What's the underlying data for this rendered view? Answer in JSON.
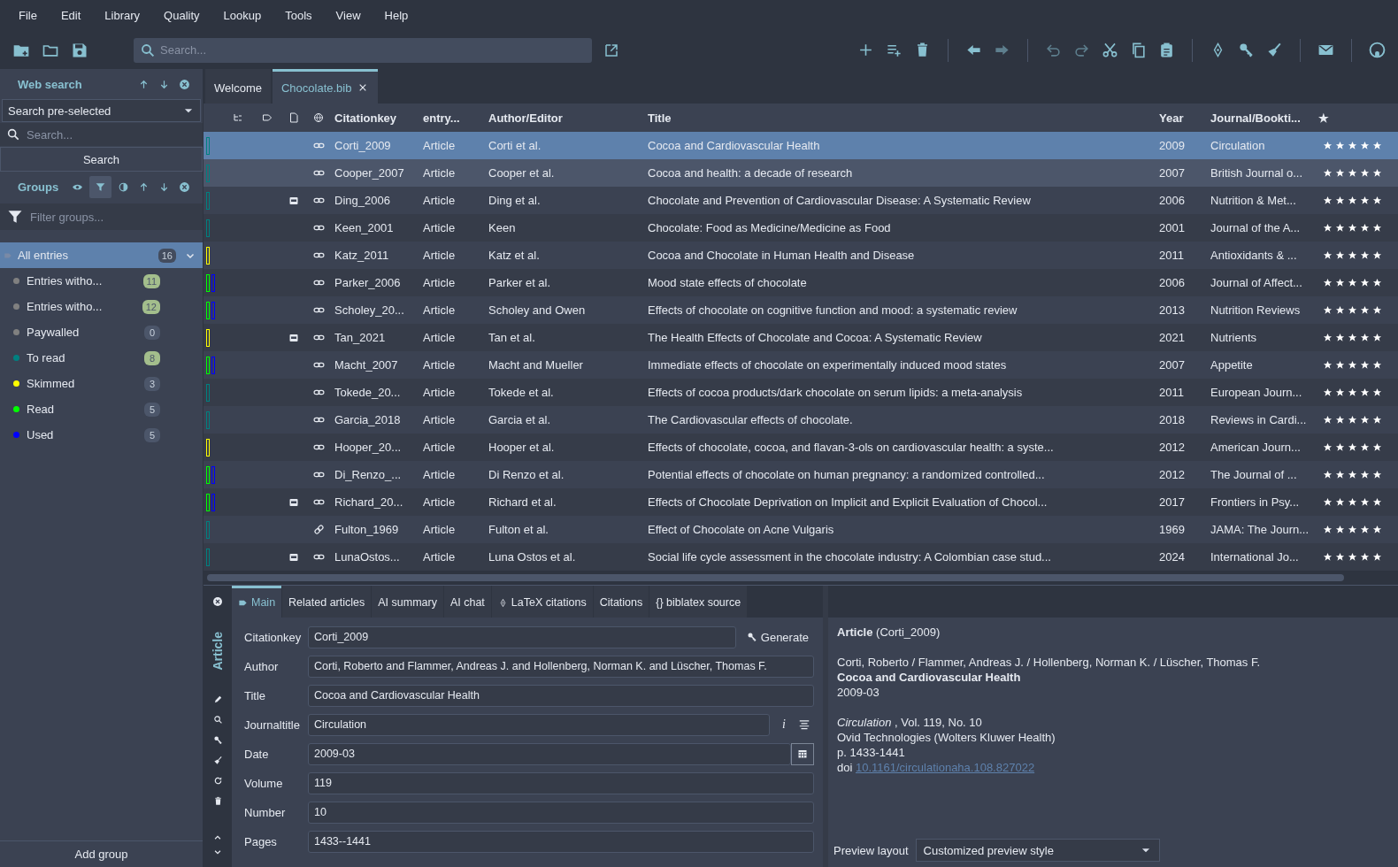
{
  "menu": [
    "File",
    "Edit",
    "Library",
    "Quality",
    "Lookup",
    "Tools",
    "View",
    "Help"
  ],
  "toolbar": {
    "search": {
      "placeholder": "Search..."
    }
  },
  "sidebar": {
    "web_search": {
      "title": "Web search",
      "dropdown": "Search pre-selected",
      "search_placeholder": "Search...",
      "button": "Search"
    },
    "groups": {
      "title": "Groups",
      "filter_placeholder": "Filter groups...",
      "add_button": "Add group",
      "items": [
        {
          "label": "All entries",
          "count": "16",
          "selected": true,
          "expanded": true,
          "children": [
            {
              "label": "Entries witho...",
              "count": "11",
              "color": "#808080",
              "highlighted": true
            },
            {
              "label": "Entries witho...",
              "count": "12",
              "color": "#808080",
              "highlighted": true
            },
            {
              "label": "Paywalled",
              "count": "0",
              "color": "#808080",
              "highlighted": false
            },
            {
              "label": "To read",
              "count": "8",
              "color": "#008080",
              "highlighted": true
            },
            {
              "label": "Skimmed",
              "count": "3",
              "color": "#ffff00",
              "highlighted": false
            },
            {
              "label": "Read",
              "count": "5",
              "color": "#00ff00",
              "highlighted": false
            },
            {
              "label": "Used",
              "count": "5",
              "color": "#0000ff",
              "highlighted": false
            }
          ]
        }
      ]
    }
  },
  "tabs": [
    {
      "label": "Welcome",
      "selected": false,
      "closable": false
    },
    {
      "label": "Chocolate.bib",
      "selected": true,
      "closable": true
    }
  ],
  "table": {
    "columns": [
      "Citationkey",
      "entry...",
      "Author/Editor",
      "Title",
      "Year",
      "Journal/Bookti...",
      "★"
    ],
    "rows": [
      {
        "key": "Corti_2009",
        "type": "Article",
        "author": "Corti et al.",
        "title": "Cocoa and Cardiovascular Health",
        "year": "2009",
        "journal": "Circulation",
        "groups": [
          {
            "color": "#008080"
          }
        ],
        "pdf": false,
        "link_tilted": false,
        "stars": 5,
        "selected": true,
        "hovered": false
      },
      {
        "key": "Cooper_2007",
        "type": "Article",
        "author": "Cooper et al.",
        "title": "Cocoa and health: a decade of research",
        "year": "2007",
        "journal": "British Journal o...",
        "groups": [
          {
            "color": "#008080"
          }
        ],
        "pdf": false,
        "link_tilted": false,
        "stars": 5,
        "selected": false,
        "hovered": true
      },
      {
        "key": "Ding_2006",
        "type": "Article",
        "author": "Ding et al.",
        "title": "Chocolate and Prevention of Cardiovascular Disease: A Systematic Review",
        "year": "2006",
        "journal": "Nutrition & Met...",
        "groups": [
          {
            "color": "#008080"
          }
        ],
        "pdf": true,
        "link_tilted": false,
        "stars": 5,
        "selected": false,
        "hovered": false
      },
      {
        "key": "Keen_2001",
        "type": "Article",
        "author": "Keen",
        "title": "Chocolate: Food as Medicine/Medicine as Food",
        "year": "2001",
        "journal": "Journal of the A...",
        "groups": [
          {
            "color": "#008080"
          }
        ],
        "pdf": false,
        "link_tilted": false,
        "stars": 5,
        "selected": false,
        "hovered": false
      },
      {
        "key": "Katz_2011",
        "type": "Article",
        "author": "Katz et al.",
        "title": "Cocoa and Chocolate in Human Health and Disease",
        "year": "2011",
        "journal": "Antioxidants & ...",
        "groups": [
          {
            "color": "#ffff00"
          }
        ],
        "pdf": false,
        "link_tilted": false,
        "stars": 5,
        "selected": false,
        "hovered": false
      },
      {
        "key": "Parker_2006",
        "type": "Article",
        "author": "Parker et al.",
        "title": "Mood state effects of chocolate",
        "year": "2006",
        "journal": "Journal of Affect...",
        "groups": [
          {
            "color": "#00ff00"
          },
          {
            "color": "#0000ff"
          }
        ],
        "pdf": false,
        "link_tilted": false,
        "stars": 5,
        "selected": false,
        "hovered": false
      },
      {
        "key": "Scholey_20...",
        "type": "Article",
        "author": "Scholey and Owen",
        "title": "Effects of chocolate on cognitive function and mood: a systematic review",
        "year": "2013",
        "journal": "Nutrition Reviews",
        "groups": [
          {
            "color": "#00ff00"
          },
          {
            "color": "#0000ff"
          }
        ],
        "pdf": false,
        "link_tilted": false,
        "stars": 5,
        "selected": false,
        "hovered": false
      },
      {
        "key": "Tan_2021",
        "type": "Article",
        "author": "Tan et al.",
        "title": "The Health Effects of Chocolate and Cocoa: A Systematic Review",
        "year": "2021",
        "journal": "Nutrients",
        "groups": [
          {
            "color": "#ffff00"
          }
        ],
        "pdf": true,
        "link_tilted": false,
        "stars": 5,
        "selected": false,
        "hovered": false
      },
      {
        "key": "Macht_2007",
        "type": "Article",
        "author": "Macht and Mueller",
        "title": "Immediate effects of chocolate on experimentally induced mood states",
        "year": "2007",
        "journal": "Appetite",
        "groups": [
          {
            "color": "#00ff00"
          },
          {
            "color": "#0000ff"
          }
        ],
        "pdf": false,
        "link_tilted": false,
        "stars": 5,
        "selected": false,
        "hovered": false
      },
      {
        "key": "Tokede_20...",
        "type": "Article",
        "author": "Tokede et al.",
        "title": "Effects of cocoa products/dark chocolate on serum lipids: a meta-analysis",
        "year": "2011",
        "journal": "European Journ...",
        "groups": [
          {
            "color": "#008080"
          }
        ],
        "pdf": false,
        "link_tilted": false,
        "stars": 5,
        "selected": false,
        "hovered": false
      },
      {
        "key": "Garcia_2018",
        "type": "Article",
        "author": "Garcia et al.",
        "title": "The Cardiovascular effects of chocolate.",
        "year": "2018",
        "journal": "Reviews in Cardi...",
        "groups": [
          {
            "color": "#008080"
          }
        ],
        "pdf": false,
        "link_tilted": false,
        "stars": 5,
        "selected": false,
        "hovered": false
      },
      {
        "key": "Hooper_20...",
        "type": "Article",
        "author": "Hooper et al.",
        "title": "Effects of chocolate, cocoa, and flavan-3-ols on cardiovascular health: a syste...",
        "year": "2012",
        "journal": "American Journ...",
        "groups": [
          {
            "color": "#ffff00"
          }
        ],
        "pdf": false,
        "link_tilted": false,
        "stars": 5,
        "selected": false,
        "hovered": false
      },
      {
        "key": "Di_Renzo_...",
        "type": "Article",
        "author": "Di Renzo et al.",
        "title": "Potential effects of chocolate on human pregnancy: a randomized controlled...",
        "year": "2012",
        "journal": "The Journal of ...",
        "groups": [
          {
            "color": "#00ff00"
          },
          {
            "color": "#0000ff"
          }
        ],
        "pdf": false,
        "link_tilted": false,
        "stars": 5,
        "selected": false,
        "hovered": false
      },
      {
        "key": "Richard_20...",
        "type": "Article",
        "author": "Richard et al.",
        "title": "Effects of Chocolate Deprivation on Implicit and Explicit Evaluation of Chocol...",
        "year": "2017",
        "journal": "Frontiers in Psy...",
        "groups": [
          {
            "color": "#00ff00"
          },
          {
            "color": "#0000ff"
          }
        ],
        "pdf": true,
        "link_tilted": false,
        "stars": 5,
        "selected": false,
        "hovered": false
      },
      {
        "key": "Fulton_1969",
        "type": "Article",
        "author": "Fulton et al.",
        "title": "Effect of Chocolate on Acne Vulgaris",
        "year": "1969",
        "journal": "JAMA: The Journ...",
        "groups": [
          {
            "color": "#008080"
          }
        ],
        "pdf": false,
        "link_tilted": true,
        "stars": 5,
        "selected": false,
        "hovered": false
      },
      {
        "key": "LunaOstos...",
        "type": "Article",
        "author": "Luna Ostos et al.",
        "title": "Social life cycle assessment in the chocolate industry: A Colombian case stud...",
        "year": "2024",
        "journal": "International Jo...",
        "groups": [
          {
            "color": "#008080"
          }
        ],
        "pdf": true,
        "link_tilted": false,
        "stars": 5,
        "selected": false,
        "hovered": false
      }
    ]
  },
  "editor": {
    "entry_type": "Article",
    "tabs": [
      {
        "label": "Main",
        "kind": "tag",
        "selected": true
      },
      {
        "label": "Related articles",
        "kind": "plain",
        "selected": false
      },
      {
        "label": "AI summary",
        "kind": "plain",
        "selected": false
      },
      {
        "label": "AI chat",
        "kind": "plain",
        "selected": false
      },
      {
        "label": "LaTeX citations",
        "kind": "tex",
        "selected": false
      },
      {
        "label": "Citations",
        "kind": "plain",
        "selected": false
      },
      {
        "label": "{} biblatex source",
        "kind": "plain",
        "selected": false
      }
    ],
    "fields": [
      {
        "label": "Citationkey",
        "value": "Corti_2009",
        "kind": "key",
        "button": "Generate"
      },
      {
        "label": "Author",
        "value": "Corti, Roberto and Flammer, Andreas J. and Hollenberg, Norman K. and Lüscher, Thomas F.",
        "kind": "text"
      },
      {
        "label": "Title",
        "value": "Cocoa and Cardiovascular Health",
        "kind": "text"
      },
      {
        "label": "Journaltitle",
        "value": "Circulation",
        "kind": "journal",
        "button": "i"
      },
      {
        "label": "Date",
        "value": "2009-03",
        "kind": "date"
      },
      {
        "label": "Volume",
        "value": "119",
        "kind": "text"
      },
      {
        "label": "Number",
        "value": "10",
        "kind": "text"
      },
      {
        "label": "Pages",
        "value": "1433--1441",
        "kind": "text"
      }
    ]
  },
  "preview": {
    "blocks": [
      [
        {
          "kind": "plain",
          "text": "**Article** (Corti_2009)"
        }
      ],
      [
        {
          "kind": "plain",
          "text": "Corti, Roberto / Flammer, Andreas J. / Hollenberg, Norman K. / Lüscher, Thomas F."
        },
        {
          "kind": "title",
          "text": "Cocoa and Cardiovascular Health"
        },
        {
          "kind": "plain",
          "text": "2009-03"
        }
      ],
      [
        {
          "kind": "plain",
          "text": "*Circulation* , Vol. 119, No. 10"
        },
        {
          "kind": "plain",
          "text": "Ovid Technologies (Wolters Kluwer Health)"
        },
        {
          "kind": "plain",
          "text": "p. 1433-1441"
        },
        {
          "kind": "doi",
          "text": "doi",
          "link": "10.1161/circulationaha.108.827022"
        }
      ]
    ],
    "layout_label": "Preview layout",
    "layout_value": "Customized preview style"
  }
}
